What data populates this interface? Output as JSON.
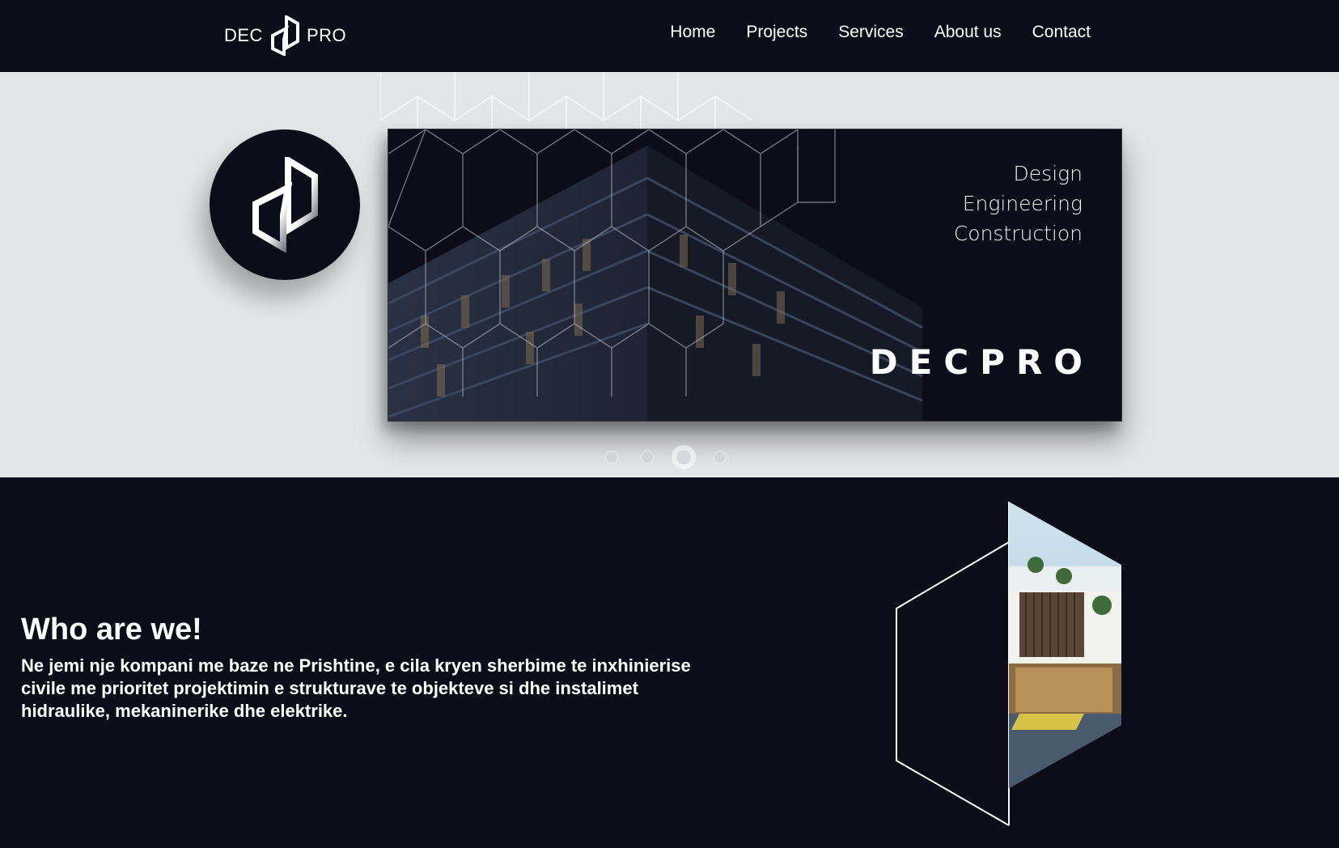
{
  "header": {
    "logo": {
      "left_text": "DEC",
      "right_text": "PRO"
    },
    "nav": [
      {
        "label": "Home"
      },
      {
        "label": "Projects"
      },
      {
        "label": "Services"
      },
      {
        "label": "About us"
      },
      {
        "label": "Contact"
      }
    ]
  },
  "hero": {
    "tagline": [
      "Design",
      "Engineering",
      "Construction"
    ],
    "brand": "DECPRO",
    "carousel": {
      "slide_count": 4,
      "active_index": 2
    }
  },
  "about": {
    "title": "Who are we!",
    "text": "Ne jemi nje kompani me baze ne Prishtine, e cila kryen sherbime te inxhinierise civile me prioritet projektimin e strukturave te objekteve si dhe instalimet hidraulike, mekaninerike dhe elektrike."
  },
  "colors": {
    "background": "#0d0d1a",
    "hero_background": "#e4e5e7",
    "text": "#ffffff"
  },
  "icons": [
    "decpro-logo-icon",
    "decpro-circle-logo-icon"
  ]
}
